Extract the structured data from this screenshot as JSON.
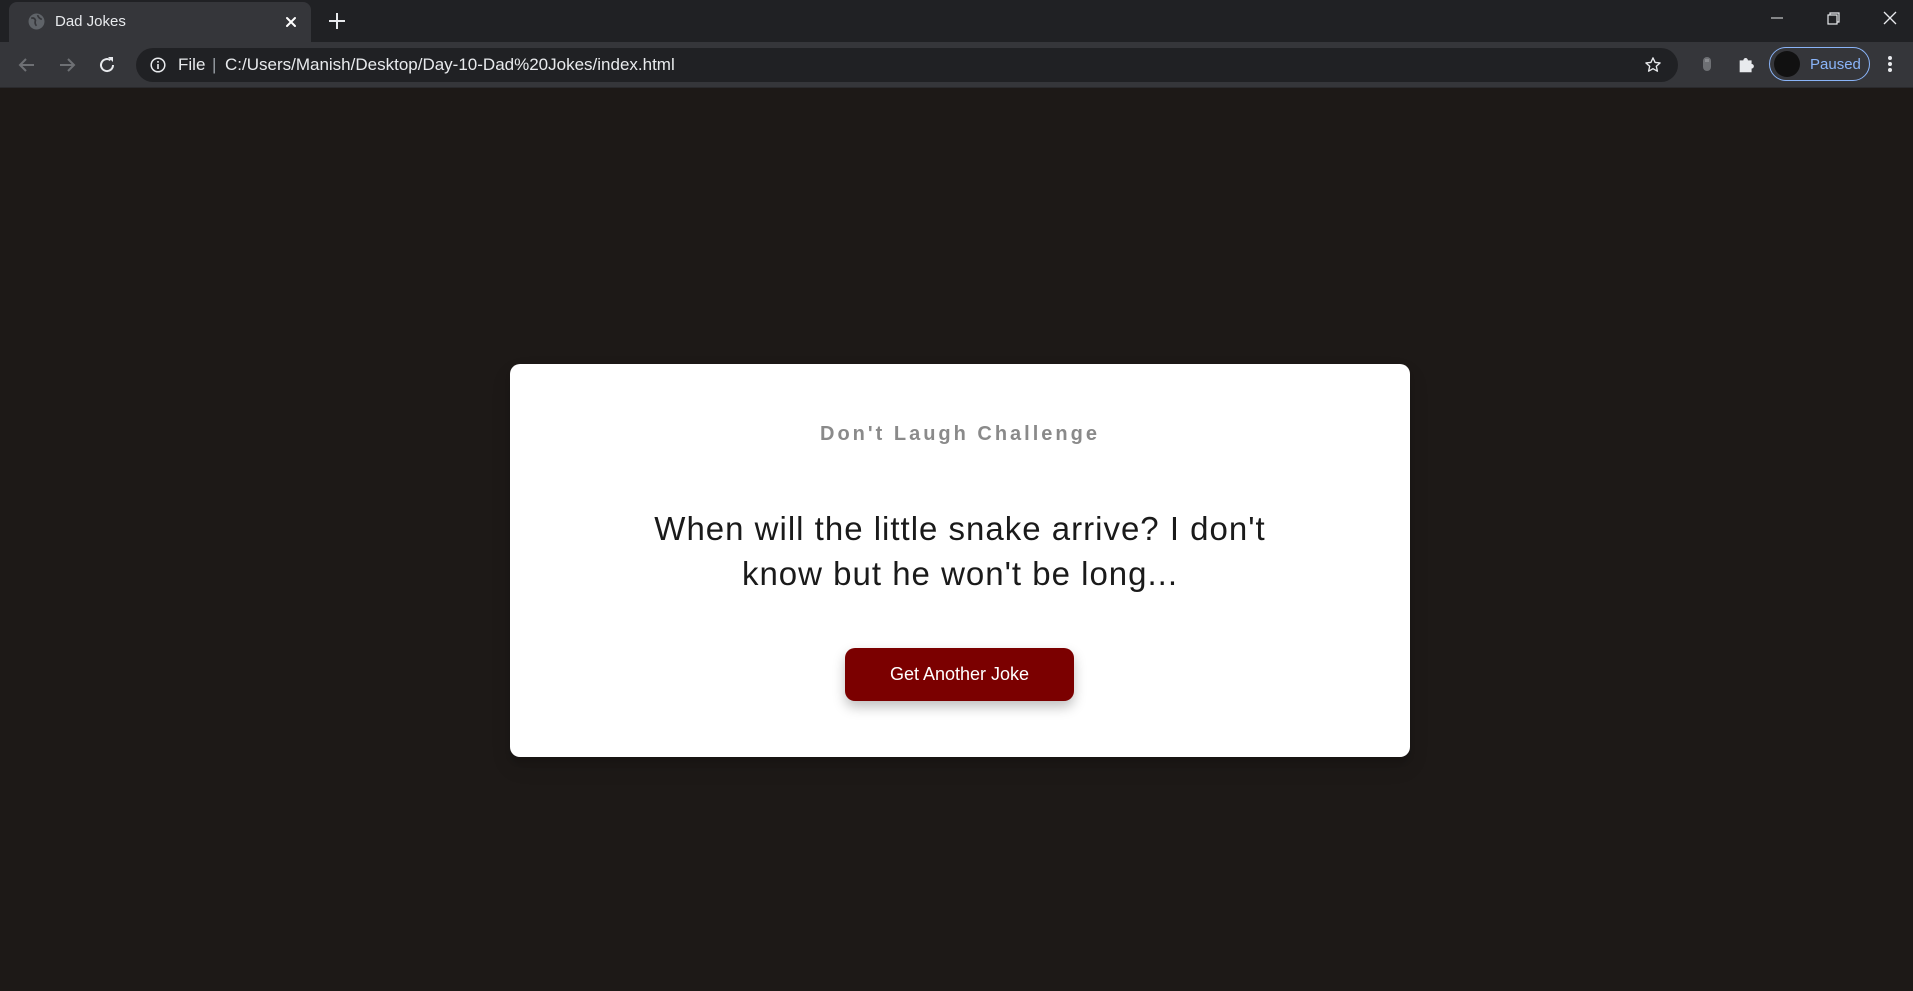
{
  "browser": {
    "tab": {
      "title": "Dad Jokes"
    },
    "address_bar": {
      "scheme_label": "File",
      "separator": "|",
      "url": "C:/Users/Manish/Desktop/Day-10-Dad%20Jokes/index.html"
    },
    "profile": {
      "status": "Paused"
    },
    "icons": {
      "tab_favicon": "globe-icon",
      "tab_close": "close-icon",
      "new_tab": "plus-icon",
      "back": "arrow-left-icon",
      "forward": "arrow-right-icon",
      "reload": "reload-icon",
      "site_info": "info-icon",
      "bookmark": "star-icon",
      "extensions": "puzzle-icon",
      "menu": "kebab-menu-icon"
    }
  },
  "page": {
    "heading": "Don't Laugh Challenge",
    "joke": "When will the little snake arrive? I don't know but he won't be long...",
    "button_label": "Get Another Joke"
  },
  "colors": {
    "page_background": "#1d1917",
    "card_background": "#ffffff",
    "button_background": "#7b0000",
    "heading_text": "#8a8a8a",
    "profile_accent": "#8ab4f8"
  }
}
